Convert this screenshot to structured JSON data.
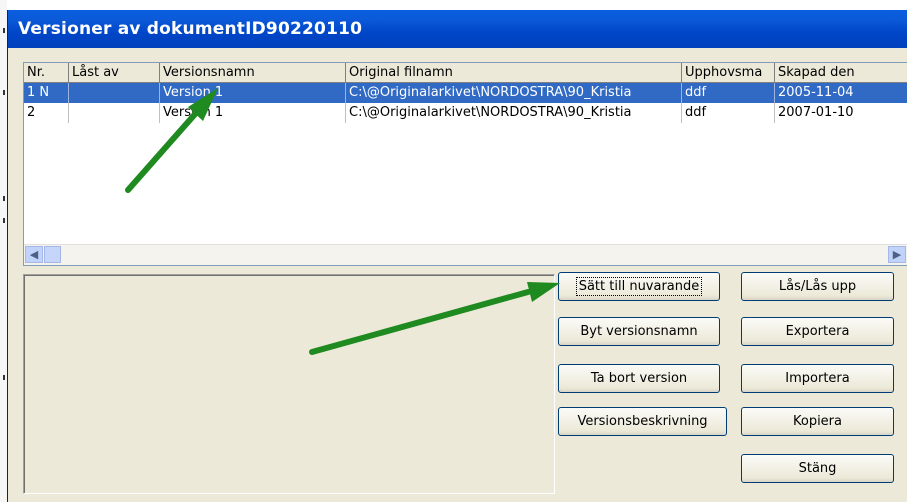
{
  "window": {
    "title": "Versioner av dokumentID90220110"
  },
  "list": {
    "columns": [
      "Nr.",
      "Låst av",
      "Versionsnamn",
      "Original filnamn",
      "Upphovsma",
      "Skapad den"
    ],
    "rows": [
      {
        "nr": "1 N",
        "locked_by": "",
        "version_name": "Version 1",
        "original_filename": "C:\\@Originalarkivet\\NORDOSTRA\\90_Kristia",
        "author": "ddf",
        "created": "2005-11-04",
        "selected": true
      },
      {
        "nr": "2",
        "locked_by": "",
        "version_name": "Version 1",
        "original_filename": "C:\\@Originalarkivet\\NORDOSTRA\\90_Kristia",
        "author": "ddf",
        "created": "2007-01-10",
        "selected": false
      }
    ]
  },
  "buttons": {
    "set_current": "Sätt till nuvarande",
    "rename_version": "Byt versionsnamn",
    "delete_version": "Ta bort version",
    "version_description": "Versionsbeskrivning",
    "lock_unlock": "Lås/Lås upp",
    "export": "Exportera",
    "import": "Importera",
    "copy": "Kopiera",
    "close": "Stäng"
  },
  "colors": {
    "titlebar": "#0046c8",
    "selection": "#316ac5",
    "annotation_arrow": "#1f8a1f"
  },
  "icons": {
    "scroll_left": "chevron-left-icon",
    "scroll_right": "chevron-right-icon"
  }
}
